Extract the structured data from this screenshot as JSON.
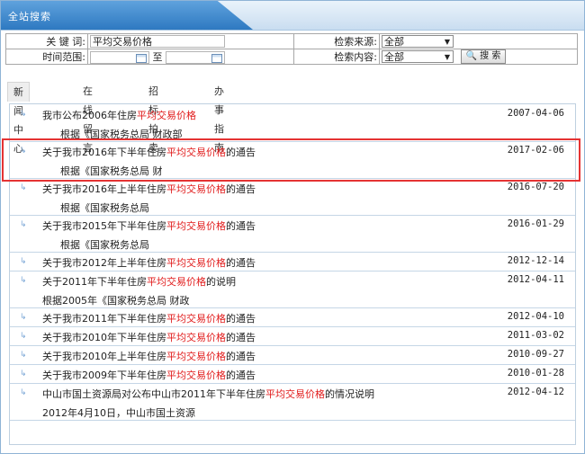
{
  "window": {
    "title": "全站搜索"
  },
  "search": {
    "keyword_label": "关 键 词:",
    "keyword_value": "平均交易价格",
    "date_label": "时间范围:",
    "date_to": "至",
    "source_label": "检索来源:",
    "source_value": "全部",
    "content_label": "检索内容:",
    "content_value": "全部",
    "search_button": "搜 索"
  },
  "tabs": [
    "新闻中心",
    "在线留言",
    "招标拍卖",
    "办事指南"
  ],
  "results": [
    {
      "pre": "我市公布2006年住房",
      "hl": "平均交易价格",
      "post": "",
      "date": "2007-04-06",
      "sub": "根据《国家税务总局 财政部"
    },
    {
      "pre": "关于我市2016年下半年住房",
      "hl": "平均交易价格",
      "post": "的通告",
      "date": "2017-02-06",
      "sub": "根据《国家税务总局 财"
    },
    {
      "pre": "关于我市2016年上半年住房",
      "hl": "平均交易价格",
      "post": "的通告",
      "date": "2016-07-20",
      "sub": "根据《国家税务总局"
    },
    {
      "pre": "关于我市2015年下半年住房",
      "hl": "平均交易价格",
      "post": "的通告",
      "date": "2016-01-29",
      "sub": "根据《国家税务总局"
    },
    {
      "pre": "关于我市2012年上半年住房",
      "hl": "平均交易价格",
      "post": "的通告",
      "date": "2012-12-14",
      "sub": ""
    },
    {
      "pre": "关于2011年下半年住房",
      "hl": "平均交易价格",
      "post": "的说明",
      "date": "2012-04-11",
      "sub": "根据2005年《国家税务总局 财政"
    },
    {
      "pre": "关于我市2011年下半年住房",
      "hl": "平均交易价格",
      "post": "的通告",
      "date": "2012-04-10",
      "sub": ""
    },
    {
      "pre": "关于我市2010年下半年住房",
      "hl": "平均交易价格",
      "post": "的通告",
      "date": "2011-03-02",
      "sub": ""
    },
    {
      "pre": "关于我市2010年上半年住房",
      "hl": "平均交易价格",
      "post": "的通告",
      "date": "2010-09-27",
      "sub": ""
    },
    {
      "pre": "关于我市2009年下半年住房",
      "hl": "平均交易价格",
      "post": "的通告",
      "date": "2010-01-28",
      "sub": ""
    },
    {
      "pre": "中山市国土资源局对公布中山市2011年下半年住房",
      "hl": "平均交易价格",
      "post": "的情况说明",
      "date": "2012-04-12",
      "sub": "2012年4月10日，中山市国土资源"
    }
  ]
}
